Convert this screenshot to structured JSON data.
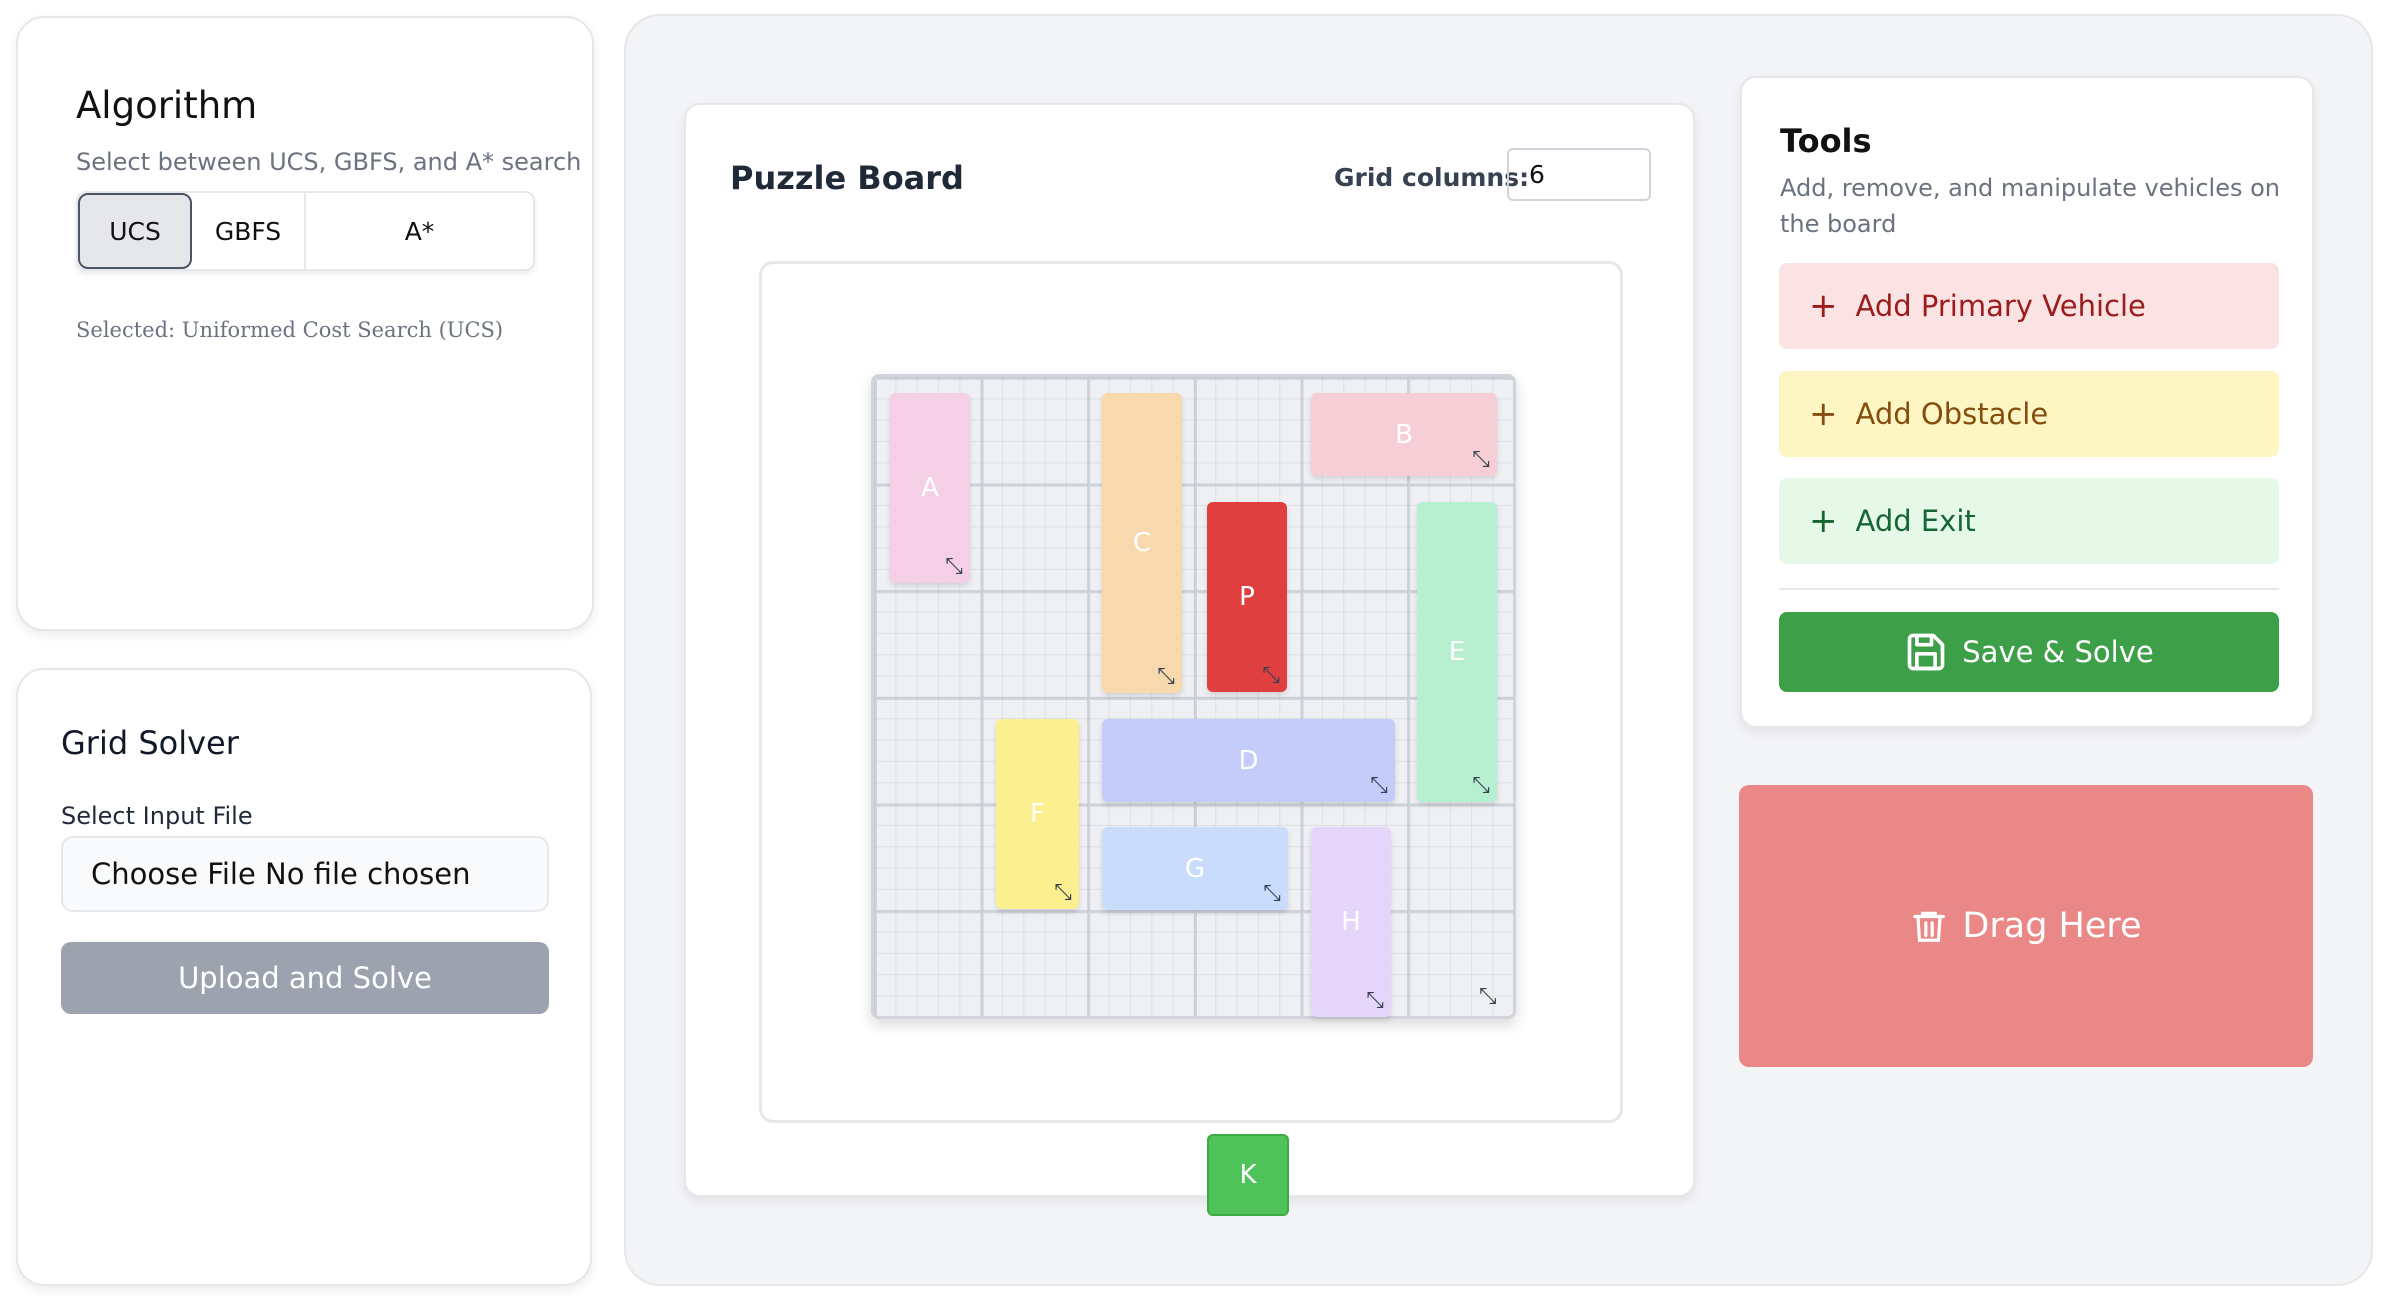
{
  "algorithm": {
    "title": "Algorithm",
    "subtitle": "Select between UCS, GBFS, and A* search",
    "options": [
      "UCS",
      "GBFS",
      "A*"
    ],
    "selected_index": 0,
    "selected_text": "Selected: Uniformed Cost Search (UCS)"
  },
  "grid_solver": {
    "title": "Grid Solver",
    "input_label": "Select Input File",
    "file_input_text": "Choose File No file chosen",
    "upload_label": "Upload and Solve"
  },
  "board": {
    "title": "Puzzle Board",
    "grid_columns_label": "Grid columns:",
    "grid_columns_value": "6",
    "exit_label": "K",
    "vehicles": [
      {
        "label": "A",
        "color": "#f5cfe6"
      },
      {
        "label": "B",
        "color": "#f6cfd6"
      },
      {
        "label": "C",
        "color": "#f8d8ad"
      },
      {
        "label": "P",
        "color": "#e03f3f"
      },
      {
        "label": "E",
        "color": "#b6f0d1"
      },
      {
        "label": "D",
        "color": "#c4ccfa"
      },
      {
        "label": "F",
        "color": "#fbef90"
      },
      {
        "label": "G",
        "color": "#c9dcfb"
      },
      {
        "label": "H",
        "color": "#e5d5fb"
      }
    ],
    "resize_icon": "resize-arrow-icon"
  },
  "tools": {
    "title": "Tools",
    "description": "Add, remove, and manipulate vehicles on the board",
    "add_primary": "Add Primary Vehicle",
    "add_obstacle": "Add Obstacle",
    "add_exit": "Add Exit",
    "plus_glyph": "+",
    "save_solve": "Save & Solve"
  },
  "trash": {
    "label": "Drag Here",
    "icon": "trash-icon"
  },
  "colors": {
    "save_green": "#3d9f48",
    "trash_red": "#e98886",
    "primary_red": "#e03f3f",
    "exit_green": "#4fc35a"
  }
}
